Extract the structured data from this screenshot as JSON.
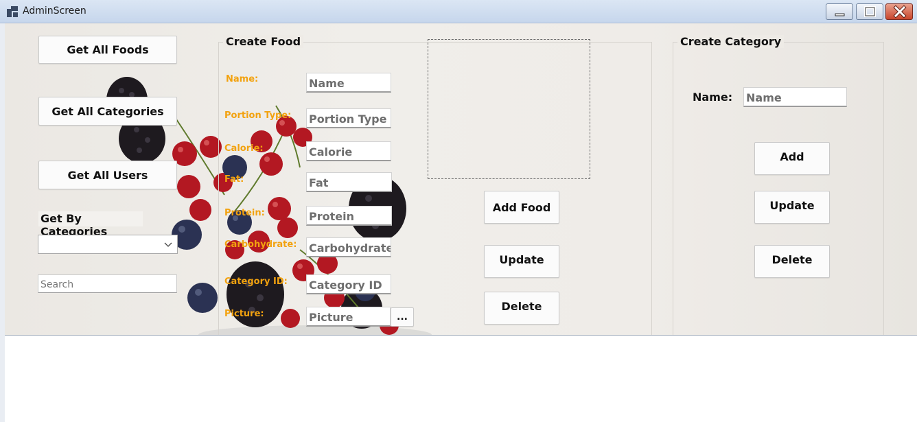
{
  "window": {
    "title": "AdminScreen"
  },
  "left_panel": {
    "get_all_foods": "Get All Foods",
    "get_all_categories": "Get All Categories",
    "get_all_users": "Get All Users",
    "get_by_categories_label": "Get By Categories",
    "category_select_value": "",
    "search_placeholder": "Search"
  },
  "create_food": {
    "title": "Create Food",
    "fields": [
      {
        "label": "Name:",
        "placeholder": "Name"
      },
      {
        "label": "Portion Type:",
        "placeholder": "Portion Type"
      },
      {
        "label": "Calorie:",
        "placeholder": "Calorie"
      },
      {
        "label": "Fat:",
        "placeholder": "Fat"
      },
      {
        "label": "Protein:",
        "placeholder": "Protein"
      },
      {
        "label": "Carbohydrate:",
        "placeholder": "Carbohydrate"
      },
      {
        "label": "Category ID:",
        "placeholder": "Category ID"
      },
      {
        "label": "Picture:",
        "placeholder": "Picture"
      }
    ],
    "browse_button": "...",
    "add_button": "Add Food",
    "update_button": "Update",
    "delete_button": "Delete"
  },
  "create_category": {
    "title": "Create Category",
    "name_label": "Name:",
    "name_placeholder": "Name",
    "add_button": "Add",
    "update_button": "Update",
    "delete_button": "Delete"
  }
}
